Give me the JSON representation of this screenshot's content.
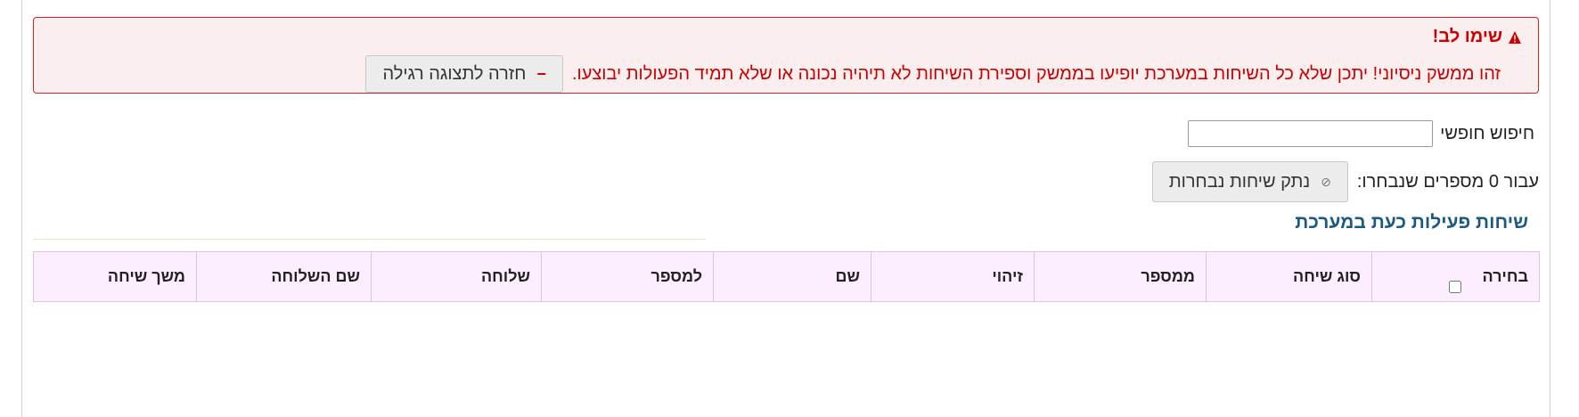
{
  "alert": {
    "title": "שימו לב!",
    "message": "זהו ממשק ניסיוני! יתכן שלא כל השיחות במערכת יופיעו בממשק וספירת השיחות לא תיהיה נכונה או שלא תמיד הפעולות יבוצעו.",
    "return_button": "חזרה לתצוגה רגילה"
  },
  "search": {
    "label": "חיפוש חופשי",
    "value": ""
  },
  "selection": {
    "label": "עבור 0 מספרים שנבחרו:",
    "disconnect_button": "נתק שיחות נבחרות"
  },
  "section": {
    "title": "שיחות פעילות כעת במערכת"
  },
  "table": {
    "headers": [
      "בחירה",
      "סוג שיחה",
      "ממספר",
      "זיהוי",
      "שם",
      "למספר",
      "שלוחה",
      "שם השלוחה",
      "משך שיחה"
    ]
  },
  "colors": {
    "alert_text": "#cc0000",
    "alert_bg": "#fbeeee",
    "section_title": "#1d5a80",
    "table_header_bg": "#fdeeff"
  }
}
